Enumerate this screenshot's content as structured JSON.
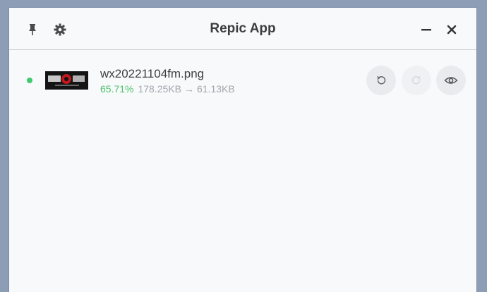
{
  "window": {
    "title": "Repic App"
  },
  "titlebar": {
    "pin_icon": "pin-icon",
    "settings_icon": "gear-icon",
    "minimize_icon": "minimize-icon",
    "close_icon": "close-icon"
  },
  "files": [
    {
      "name": "wx20221104fm.png",
      "ratio": "65.71%",
      "original_size": "178.25KB",
      "arrow": "→",
      "compressed_size": "61.13KB",
      "status_color": "#3fcb6e"
    }
  ],
  "colors": {
    "accent_green": "#4bc36d",
    "window_bg": "#f8f9fb",
    "desktop_bg": "#8d9db6"
  }
}
